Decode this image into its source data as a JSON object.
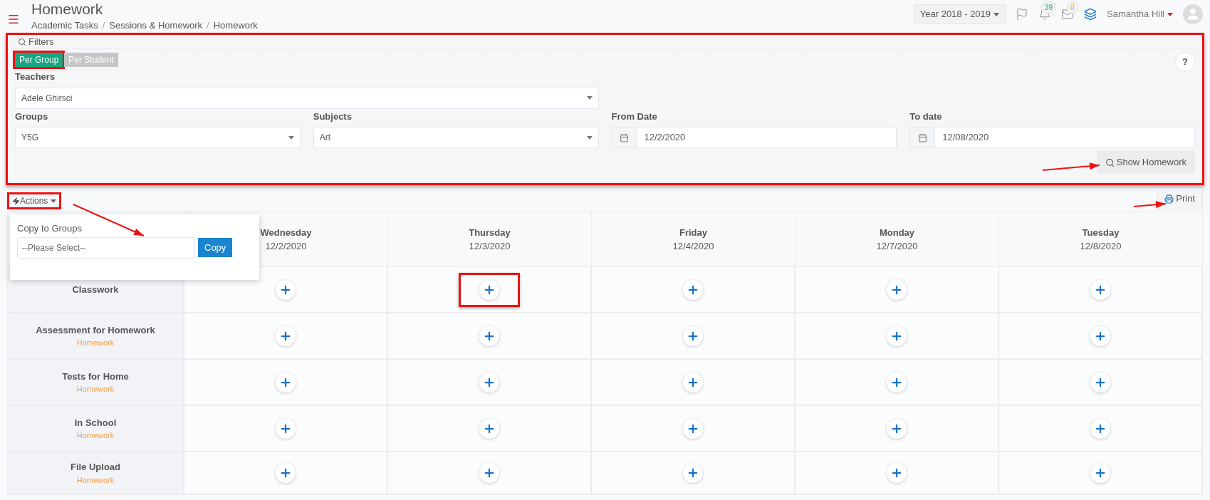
{
  "header": {
    "title": "Homework",
    "breadcrumbs": [
      "Academic Tasks",
      "Sessions & Homework",
      "Homework"
    ],
    "separator": "/",
    "year": "Year 2018 - 2019",
    "notifications": "39",
    "messages": "0",
    "user": "Samantha Hill"
  },
  "filters": {
    "title": "Filters",
    "highlighted": true,
    "help": "?",
    "modes": [
      {
        "label": "Per Group",
        "selected": true,
        "highlighted": true
      },
      {
        "label": "Per Student",
        "selected": false,
        "highlighted": false
      }
    ],
    "rows": [
      [
        {
          "kind": "select",
          "label": "Teachers",
          "value": "Adele Ghirsci"
        }
      ],
      [
        {
          "kind": "select",
          "label": "Groups",
          "value": "Y5G"
        },
        {
          "kind": "select",
          "label": "Subjects",
          "value": "Art"
        },
        {
          "kind": "date",
          "label": "From Date",
          "value": "12/2/2020"
        },
        {
          "kind": "date",
          "label": "To date",
          "value": "12/08/2020"
        }
      ]
    ],
    "button": "Show Homework"
  },
  "actions": {
    "label": "Actions",
    "highlighted": true,
    "popup": {
      "title": "Copy to Groups",
      "placeholder": "--Please Select--",
      "button": "Copy"
    }
  },
  "print": "Print",
  "table": {
    "days": [
      {
        "day": "Wednesday",
        "date": "12/2/2020"
      },
      {
        "day": "Thursday",
        "date": "12/3/2020"
      },
      {
        "day": "Friday",
        "date": "12/4/2020"
      },
      {
        "day": "Monday",
        "date": "12/7/2020"
      },
      {
        "day": "Tuesday",
        "date": "12/8/2020"
      }
    ],
    "rows": [
      {
        "name": "Classwork",
        "cells": [
          {
            "highlighted": false
          },
          {
            "highlighted": true
          },
          {
            "highlighted": false
          },
          {
            "highlighted": false
          },
          {
            "highlighted": false
          }
        ]
      },
      {
        "name": "Assessment for Homework",
        "tag": "Homework",
        "cells": [
          {
            "highlighted": false
          },
          {
            "highlighted": false
          },
          {
            "highlighted": false
          },
          {
            "highlighted": false
          },
          {
            "highlighted": false
          }
        ]
      },
      {
        "name": "Tests for Home",
        "tag": "Homework",
        "cells": [
          {
            "highlighted": false
          },
          {
            "highlighted": false
          },
          {
            "highlighted": false
          },
          {
            "highlighted": false
          },
          {
            "highlighted": false
          }
        ]
      },
      {
        "name": "In School",
        "tag": "Homework",
        "cells": [
          {
            "highlighted": false
          },
          {
            "highlighted": false
          },
          {
            "highlighted": false
          },
          {
            "highlighted": false
          },
          {
            "highlighted": false
          }
        ]
      },
      {
        "name": "File Upload",
        "tag": "Homework",
        "cells": [
          {
            "highlighted": false
          },
          {
            "highlighted": false
          },
          {
            "highlighted": false
          },
          {
            "highlighted": false
          },
          {
            "highlighted": false
          }
        ]
      }
    ]
  }
}
